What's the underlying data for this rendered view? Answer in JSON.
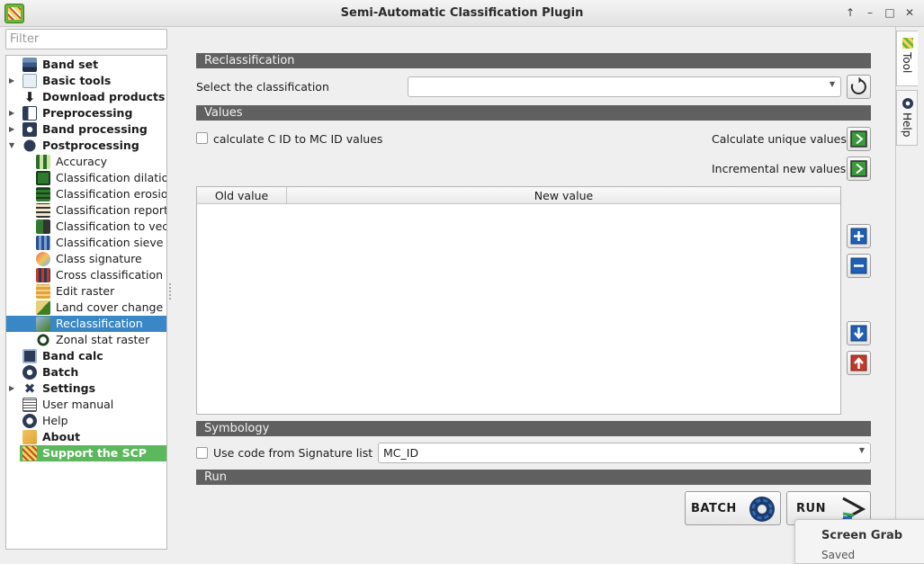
{
  "window": {
    "title": "Semi-Automatic Classification Plugin"
  },
  "filter": {
    "placeholder": "Filter"
  },
  "tree": {
    "band_set": "Band set",
    "basic_tools": "Basic tools",
    "download_products": "Download products",
    "preprocessing": "Preprocessing",
    "band_processing": "Band processing",
    "postprocessing": "Postprocessing",
    "post_items": [
      "Accuracy",
      "Classification dilation",
      "Classification erosion",
      "Classification report",
      "Classification to vector",
      "Classification sieve",
      "Class signature",
      "Cross classification",
      "Edit raster",
      "Land cover change",
      "Reclassification",
      "Zonal stat raster"
    ],
    "band_calc": "Band calc",
    "batch": "Batch",
    "settings": "Settings",
    "user_manual": "User manual",
    "help": "Help",
    "about": "About",
    "support": "Support the SCP"
  },
  "reclassification": {
    "header": "Reclassification",
    "select_label": "Select the classification",
    "select_value": ""
  },
  "values": {
    "header": "Values",
    "calc_c_id_label": "calculate C ID to MC ID values",
    "calc_c_id_checked": false,
    "calc_unique_label": "Calculate unique values",
    "incremental_label": "Incremental new values",
    "columns": [
      "Old value",
      "New value"
    ],
    "rows": []
  },
  "symbology": {
    "header": "Symbology",
    "use_code_label": "Use code from Signature list",
    "use_code_checked": false,
    "code_value": "MC_ID"
  },
  "run": {
    "header": "Run",
    "batch_label": "BATCH",
    "run_label": "RUN"
  },
  "side_tabs": {
    "tool": "Tool",
    "help": "Help"
  },
  "notification": {
    "title": "Screen Grab",
    "subtitle": "Saved"
  },
  "colors": {
    "selection": "#3a87c8",
    "support": "#5cb85c",
    "section_header": "#606060"
  }
}
